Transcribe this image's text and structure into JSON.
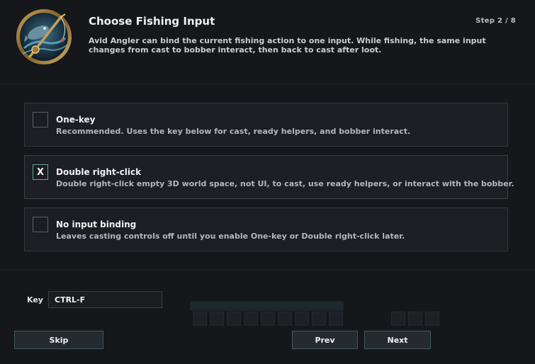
{
  "dialog": {
    "title": "Choose Fishing Input",
    "step": "Step 2 / 8",
    "description": "Avid Angler can bind the current fishing action to one input. While fishing, the same input changes from cast to bobber interact, then back to cast after loot."
  },
  "options": [
    {
      "checkbox_mark": "",
      "title": "One-key",
      "description": "Recommended. Uses the key below for cast, ready helpers, and bobber interact.",
      "selected": false
    },
    {
      "checkbox_mark": "X",
      "title": "Double right-click",
      "description": "Double right-click empty 3D world space, not UI, to cast, use ready helpers, or interact with the bobber.",
      "selected": true
    },
    {
      "checkbox_mark": "",
      "title": "No input binding",
      "description": "Leaves casting controls off until you enable One-key or Double right-click later.",
      "selected": false
    }
  ],
  "key": {
    "label": "Key",
    "value": "CTRL-F"
  },
  "buttons": {
    "skip": "Skip",
    "prev": "Prev",
    "next": "Next"
  },
  "icons": {
    "emblem": "fishing-emblem-icon"
  },
  "colors": {
    "selected_border": "#56a8a4",
    "button_border": "#3d5a5d",
    "panel": "#1c1e23"
  }
}
